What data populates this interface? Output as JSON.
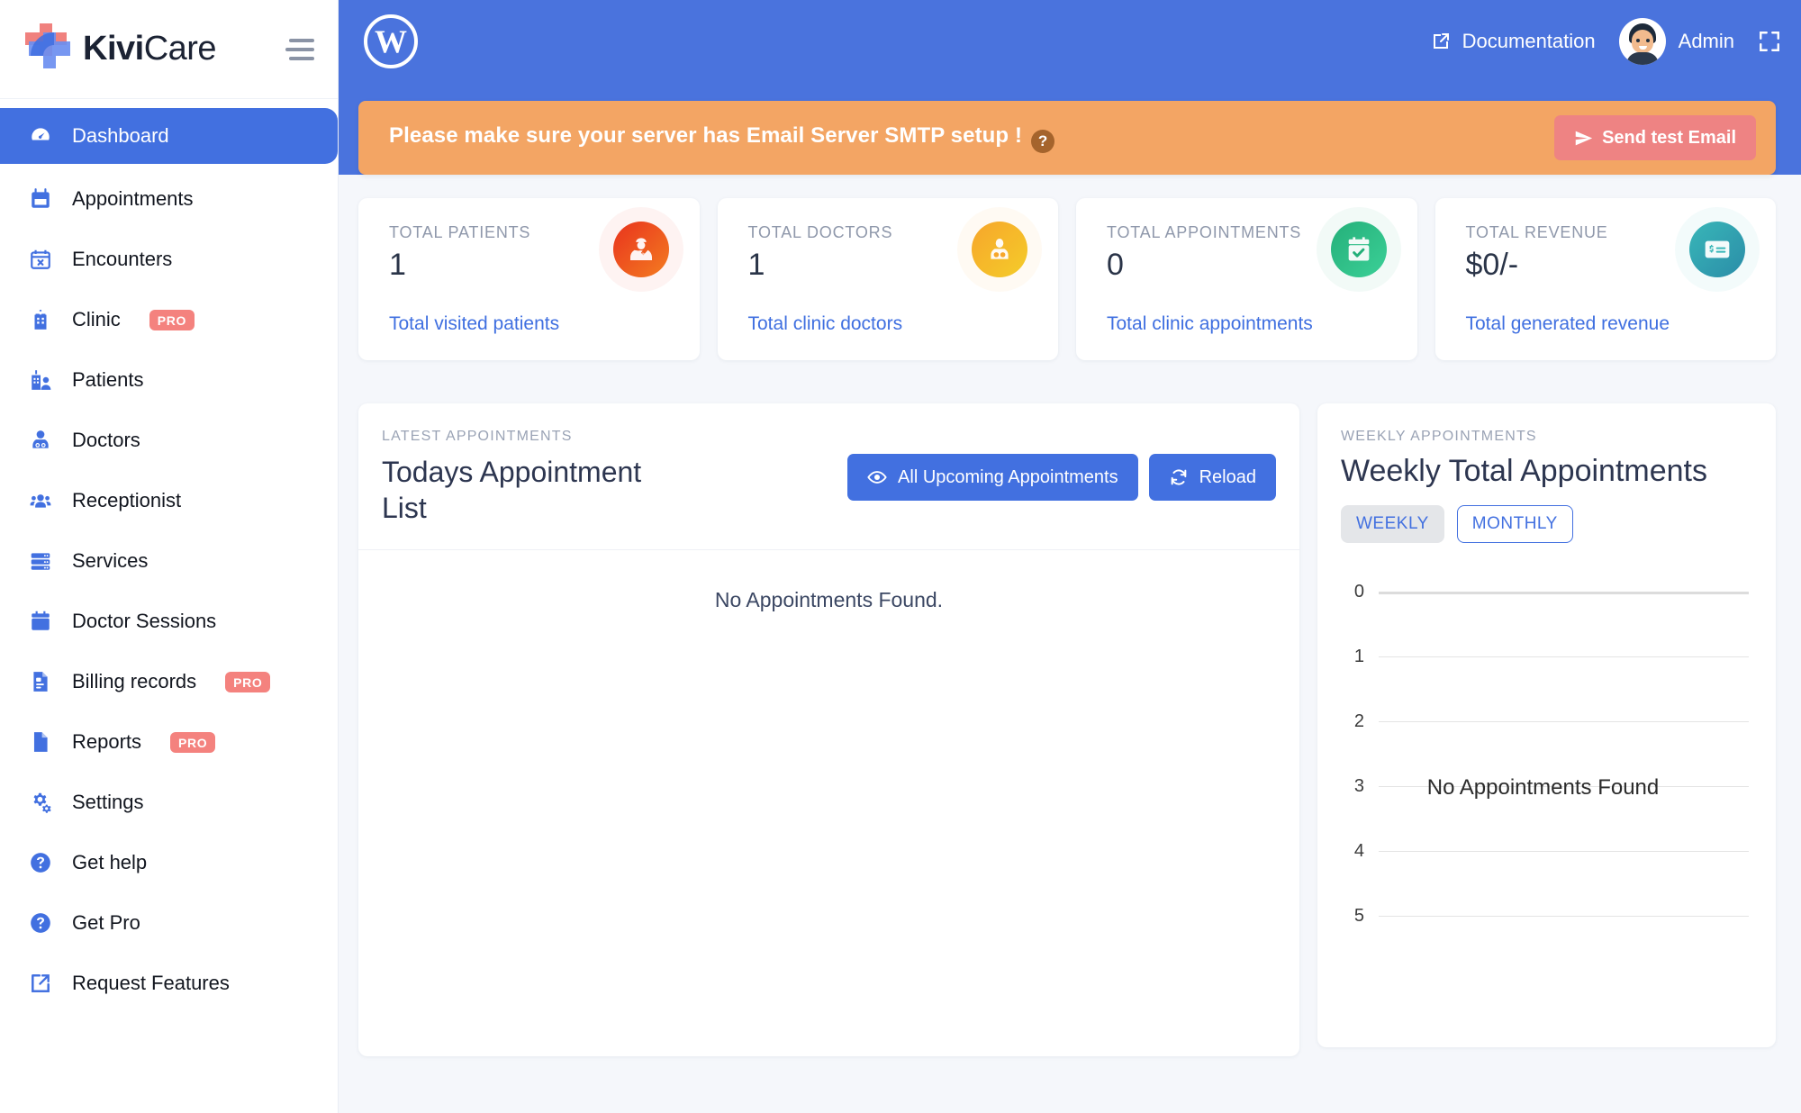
{
  "brand": {
    "name_bold": "Kivi",
    "name_light": "Care"
  },
  "sidebar": {
    "items": [
      {
        "label": "Dashboard",
        "icon": "dashboard-icon",
        "active": true,
        "pro": ""
      },
      {
        "label": "Appointments",
        "icon": "calendar-icon",
        "active": false,
        "pro": ""
      },
      {
        "label": "Encounters",
        "icon": "calendar-x-icon",
        "active": false,
        "pro": ""
      },
      {
        "label": "Clinic",
        "icon": "hospital-icon",
        "active": false,
        "pro": "PRO"
      },
      {
        "label": "Patients",
        "icon": "hospital-user-icon",
        "active": false,
        "pro": ""
      },
      {
        "label": "Doctors",
        "icon": "doctor-icon",
        "active": false,
        "pro": ""
      },
      {
        "label": "Receptionist",
        "icon": "users-icon",
        "active": false,
        "pro": ""
      },
      {
        "label": "Services",
        "icon": "server-icon",
        "active": false,
        "pro": ""
      },
      {
        "label": "Doctor Sessions",
        "icon": "calendar-solid-icon",
        "active": false,
        "pro": ""
      },
      {
        "label": "Billing records",
        "icon": "invoice-icon",
        "active": false,
        "pro": "PRO"
      },
      {
        "label": "Reports",
        "icon": "file-icon",
        "active": false,
        "pro": "PRO"
      },
      {
        "label": "Settings",
        "icon": "gears-icon",
        "active": false,
        "pro": ""
      },
      {
        "label": "Get help",
        "icon": "question-circle-icon",
        "active": false,
        "pro": ""
      },
      {
        "label": "Get Pro",
        "icon": "question-circle-icon",
        "active": false,
        "pro": ""
      },
      {
        "label": "Request Features",
        "icon": "external-link-icon",
        "active": false,
        "pro": ""
      }
    ]
  },
  "topbar": {
    "wordpress_mark": "W",
    "documentation_label": "Documentation",
    "user_name": "Admin"
  },
  "alert": {
    "message": "Please make sure your server has Email Server SMTP setup !",
    "help_glyph": "?",
    "button_label": "Send test Email"
  },
  "stats": [
    {
      "title": "TOTAL PATIENTS",
      "value": "1",
      "sub": "Total visited patients",
      "icon": "patient-icon",
      "color_from": "#e8331e",
      "color_to": "#f58220"
    },
    {
      "title": "TOTAL DOCTORS",
      "value": "1",
      "sub": "Total clinic doctors",
      "icon": "doctor-circle-icon",
      "color_from": "#f7a62b",
      "color_to": "#f4cf2a"
    },
    {
      "title": "TOTAL APPOINTMENTS",
      "value": "0",
      "sub": "Total clinic appointments",
      "icon": "calendar-check-icon",
      "color_from": "#25b07a",
      "color_to": "#3ed39a"
    },
    {
      "title": "TOTAL REVENUE",
      "value": "$0/-",
      "sub": "Total generated revenue",
      "icon": "money-check-icon",
      "color_from": "#3ab7b8",
      "color_to": "#2a8aa8"
    }
  ],
  "appointments_panel": {
    "eyebrow": "LATEST APPOINTMENTS",
    "title": "Todays Appointment List",
    "all_upcoming_label": "All Upcoming Appointments",
    "reload_label": "Reload",
    "empty_text": "No Appointments Found."
  },
  "weekly_panel": {
    "eyebrow": "WEEKLY APPOINTMENTS",
    "title": "Weekly Total Appointments",
    "toggle_weekly": "WEEKLY",
    "toggle_monthly": "MONTHLY",
    "active_toggle": "WEEKLY"
  },
  "chart_data": {
    "type": "bar",
    "title": "Weekly Total Appointments",
    "categories": [],
    "values": [],
    "series": [],
    "yticks": [
      "5",
      "4",
      "3",
      "2",
      "1",
      "0"
    ],
    "ylim": [
      0,
      5
    ],
    "xlabel": "",
    "ylabel": "",
    "grid": true,
    "legend": "none",
    "empty_text": "No Appointments Found"
  },
  "colors": {
    "accent_blue": "#4270e0",
    "topbar_blue": "#4a73dd",
    "alert_orange": "#f3a564",
    "alert_button": "#ee8383",
    "pro_badge": "#f4827e"
  }
}
